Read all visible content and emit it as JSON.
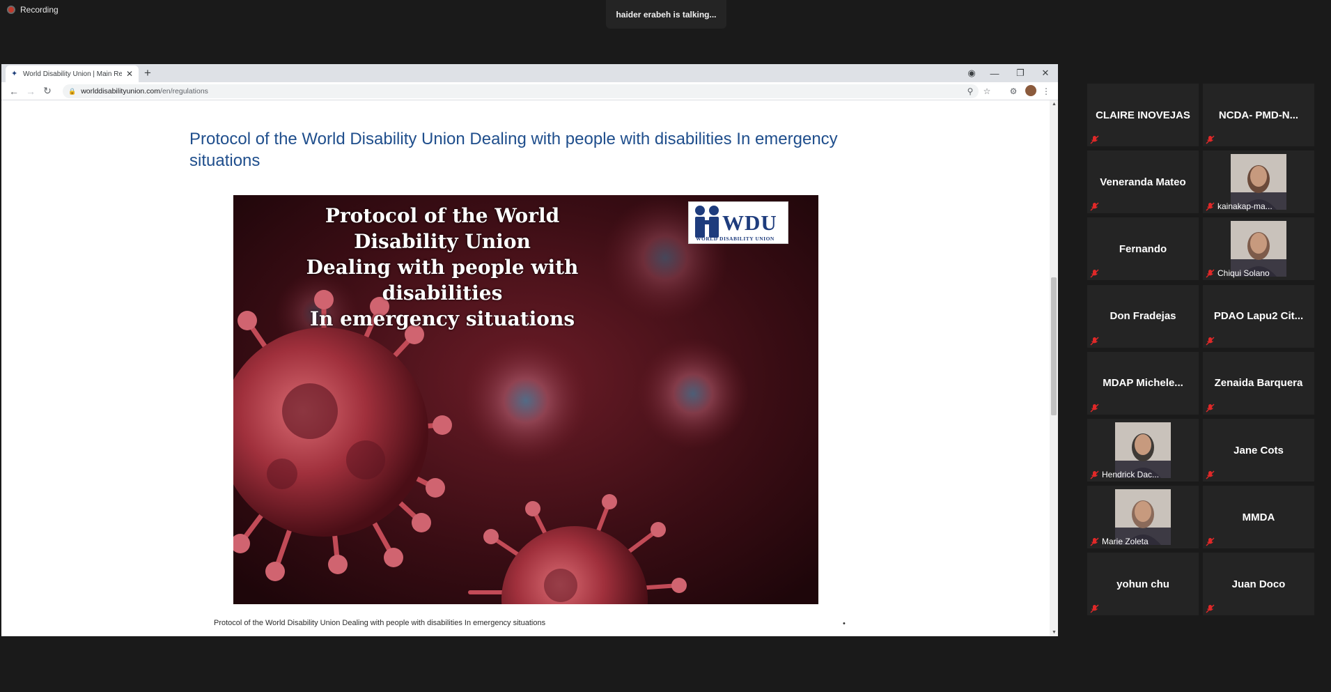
{
  "zoom": {
    "recording_label": "Recording",
    "talking_indicator": "haider erabeh is talking..."
  },
  "browser": {
    "tab_title": "World Disability Union | Main Re",
    "url_host": "worlddisabilityunion.com",
    "url_path": "/en/regulations",
    "icons": [
      "back-icon",
      "forward-icon",
      "reload-icon",
      "lock-icon",
      "zoom-icon",
      "star-icon",
      "extensions-icon",
      "profile-icon",
      "menu-icon"
    ]
  },
  "page": {
    "title": "Protocol of the World Disability Union Dealing with people with disabilities In emergency situations",
    "banner_heading_line1": "Protocol of the World Disability Union",
    "banner_heading_line2": "Dealing with people with disabilities",
    "banner_heading_line3": "In emergency situations",
    "logo_text": "WDU",
    "logo_subtext": "WORLD DISABILITY UNION",
    "caption": "Protocol of the World Disability Union Dealing with people with disabilities  In emergency situations",
    "bullet": "•"
  },
  "participants": [
    {
      "name": "CLAIRE INOVEJAS",
      "video": false,
      "muted": true
    },
    {
      "name": "NCDA-  PMD-N...",
      "video": false,
      "muted": true
    },
    {
      "name": "Veneranda Mateo",
      "video": false,
      "muted": true
    },
    {
      "name": "kainakap-ma...",
      "video": true,
      "muted": true
    },
    {
      "name": "Fernando",
      "video": false,
      "muted": true
    },
    {
      "name": "Chiqui Solano",
      "video": true,
      "muted": true
    },
    {
      "name": "Don Fradejas",
      "video": false,
      "muted": true
    },
    {
      "name": "PDAO Lapu2  Cit...",
      "video": false,
      "muted": true
    },
    {
      "name": "MDAP  Michele...",
      "video": false,
      "muted": true
    },
    {
      "name": "Zenaida Barquera",
      "video": false,
      "muted": true
    },
    {
      "name": "Hendrick Dac...",
      "video": true,
      "muted": true
    },
    {
      "name": "Jane Cots",
      "video": false,
      "muted": true
    },
    {
      "name": "Marie Zoleta",
      "video": true,
      "muted": true
    },
    {
      "name": "MMDA",
      "video": false,
      "muted": true
    },
    {
      "name": "yohun chu",
      "video": false,
      "muted": true
    },
    {
      "name": "Juan Doco",
      "video": false,
      "muted": true
    }
  ],
  "colors": {
    "zoom_bg": "#1a1a1a",
    "tile_bg": "#242424",
    "mute_red": "#e02828",
    "title_blue": "#1f4e8c"
  }
}
